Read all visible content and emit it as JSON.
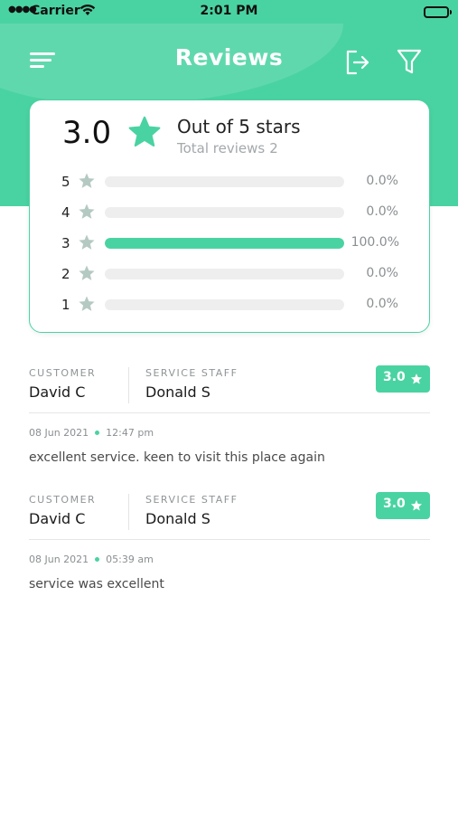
{
  "status_bar": {
    "carrier": "Carrier",
    "time": "2:01 PM"
  },
  "header": {
    "title": "Reviews",
    "icons": [
      "menu-icon",
      "logout-icon",
      "filter-icon"
    ]
  },
  "summary": {
    "average": "3.0",
    "out_of": "Out of 5 stars",
    "total_label": "Total reviews",
    "total_count": "2",
    "rows": [
      {
        "stars": "5",
        "percent": "0.0%",
        "fill": 0
      },
      {
        "stars": "4",
        "percent": "0.0%",
        "fill": 0
      },
      {
        "stars": "3",
        "percent": "100.0%",
        "fill": 1
      },
      {
        "stars": "2",
        "percent": "0.0%",
        "fill": 0
      },
      {
        "stars": "1",
        "percent": "0.0%",
        "fill": 0
      }
    ]
  },
  "reviews": [
    {
      "customer_label": "CUSTOMER",
      "customer": "David C",
      "staff_label": "SERVICE STAFF",
      "staff": "Donald S",
      "rating": "3.0",
      "date": "08 Jun 2021",
      "time": "12:47 pm",
      "comment": "excellent service. keen to visit this place again"
    },
    {
      "customer_label": "CUSTOMER",
      "customer": "David C",
      "staff_label": "SERVICE STAFF",
      "staff": "Donald S",
      "rating": "3.0",
      "date": "08 Jun 2021",
      "time": "05:39 am",
      "comment": "service was excellent"
    }
  ],
  "colors": {
    "accent": "#4ad3a2",
    "track": "#eeeeee",
    "muted_star": "#b5c9c3"
  }
}
